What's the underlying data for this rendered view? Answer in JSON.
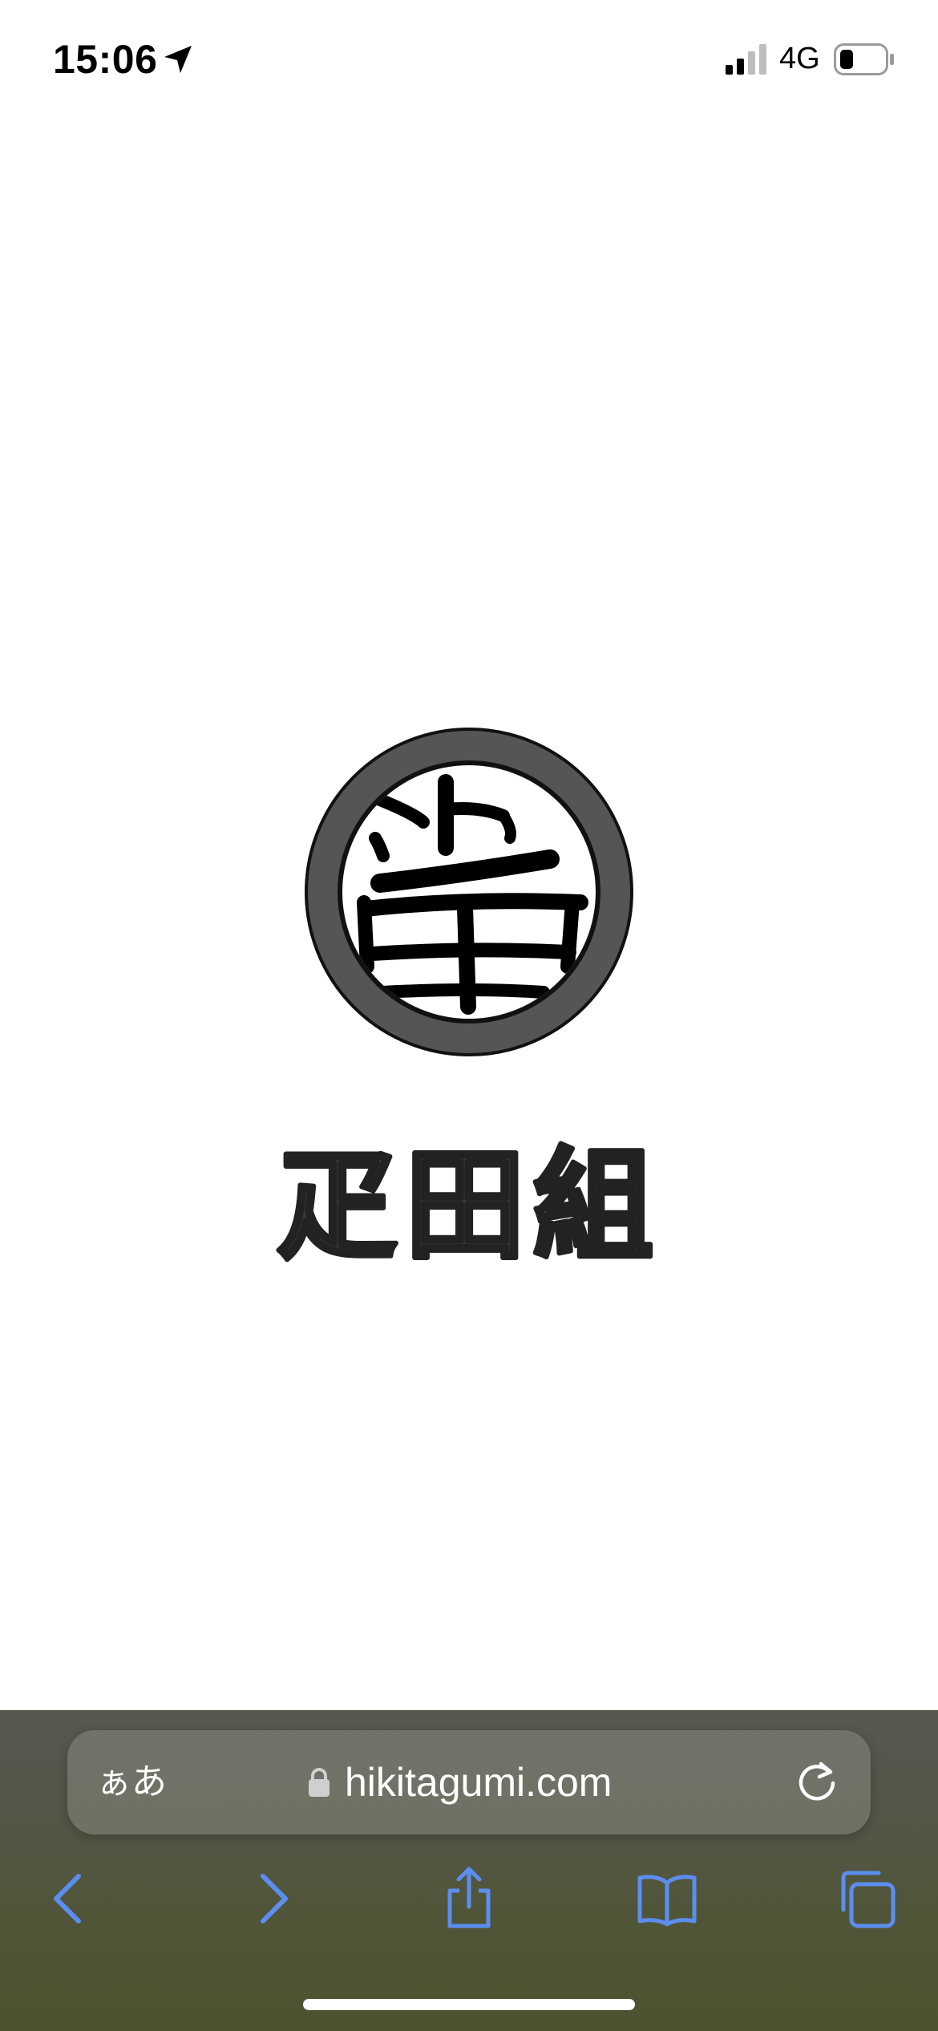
{
  "status_bar": {
    "time": "15:06",
    "network": "4G",
    "icons": {
      "location": "location-arrow-icon",
      "signal": "cellular-signal-icon",
      "battery": "battery-icon"
    },
    "signal_bars_active": 2,
    "signal_bars_total": 4,
    "battery_level_fraction": 0.25
  },
  "page": {
    "brand_name": "疋田組",
    "logo": "crest-emblem-icon",
    "background_color": "#ffffff"
  },
  "safari": {
    "text_size_label": "ぁあ",
    "url": "hikitagumi.com",
    "icons": {
      "lock": "lock-icon",
      "reload": "reload-icon",
      "back": "chevron-left-icon",
      "forward": "chevron-right-icon",
      "share": "share-icon",
      "bookmarks": "book-icon",
      "tabs": "tabs-icon"
    },
    "accent_color": "#5b8ef0"
  }
}
